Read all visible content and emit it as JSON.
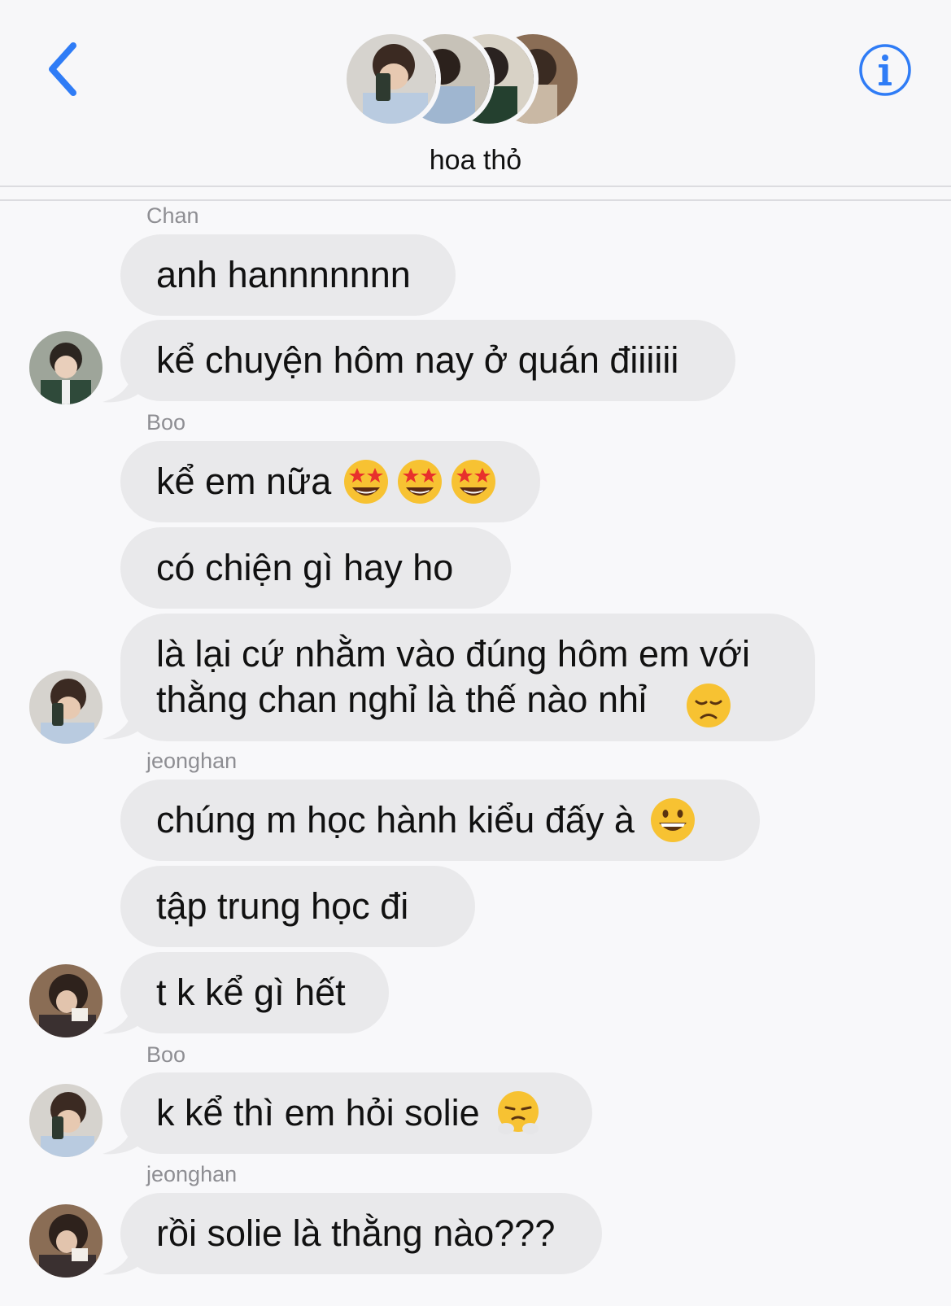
{
  "header": {
    "group_name": "hoa thỏ"
  },
  "messages": [
    {
      "sender": "Chan",
      "texts": [
        "anh hannnnnnn",
        "kể chuyện hôm nay ở quán điiiiii"
      ]
    },
    {
      "sender": "Boo",
      "texts": [
        "kể em nữa",
        "có chiện gì hay ho",
        "là lại cứ nhằm vào đúng hôm em với\nthằng chan nghỉ là thế nào nhỉ"
      ]
    },
    {
      "sender": "jeonghan",
      "texts": [
        "chúng m học hành kiểu đấy à",
        "tập trung học đi",
        "t k kể gì hết"
      ]
    },
    {
      "sender": "Boo",
      "texts": [
        "k kể thì em hỏi solie"
      ]
    },
    {
      "sender": "jeonghan",
      "texts": [
        "rồi solie là thằng nào???"
      ]
    }
  ],
  "emoji_names": [
    "star-struck-emoji",
    "disappointed-face-emoji",
    "grinning-face-emoji",
    "face-with-steam-emoji"
  ],
  "colors": {
    "accent": "#2f7cf6",
    "bubble": "#e9e9eb",
    "sender_label": "#8e8e93"
  }
}
